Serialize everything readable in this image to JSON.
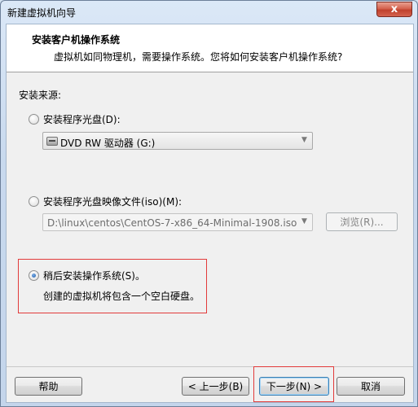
{
  "window": {
    "title": "新建虚拟机向导",
    "close_glyph": "x"
  },
  "header": {
    "title": "安装客户机操作系统",
    "subtitle": "虚拟机如同物理机，需要操作系统。您将如何安装客户机操作系统?"
  },
  "source": {
    "label": "安装来源:",
    "disc": {
      "label": "安装程序光盘(D):",
      "selected": false,
      "drive_value": "DVD RW 驱动器 (G:)"
    },
    "iso": {
      "label": "安装程序光盘映像文件(iso)(M):",
      "selected": false,
      "path_value": "D:\\linux\\centos\\CentOS-7-x86_64-Minimal-1908.iso",
      "browse_label": "浏览(R)..."
    },
    "later": {
      "label": "稍后安装操作系统(S)。",
      "selected": true,
      "description": "创建的虚拟机将包含一个空白硬盘。"
    }
  },
  "footer": {
    "help_label": "帮助",
    "back_label": "< 上一步(B)",
    "next_label": "下一步(N) >",
    "cancel_label": "取消"
  },
  "colors": {
    "highlight": "#e23b3b",
    "header_bg": "#ffffff",
    "client_bg": "#f0f0f0"
  }
}
